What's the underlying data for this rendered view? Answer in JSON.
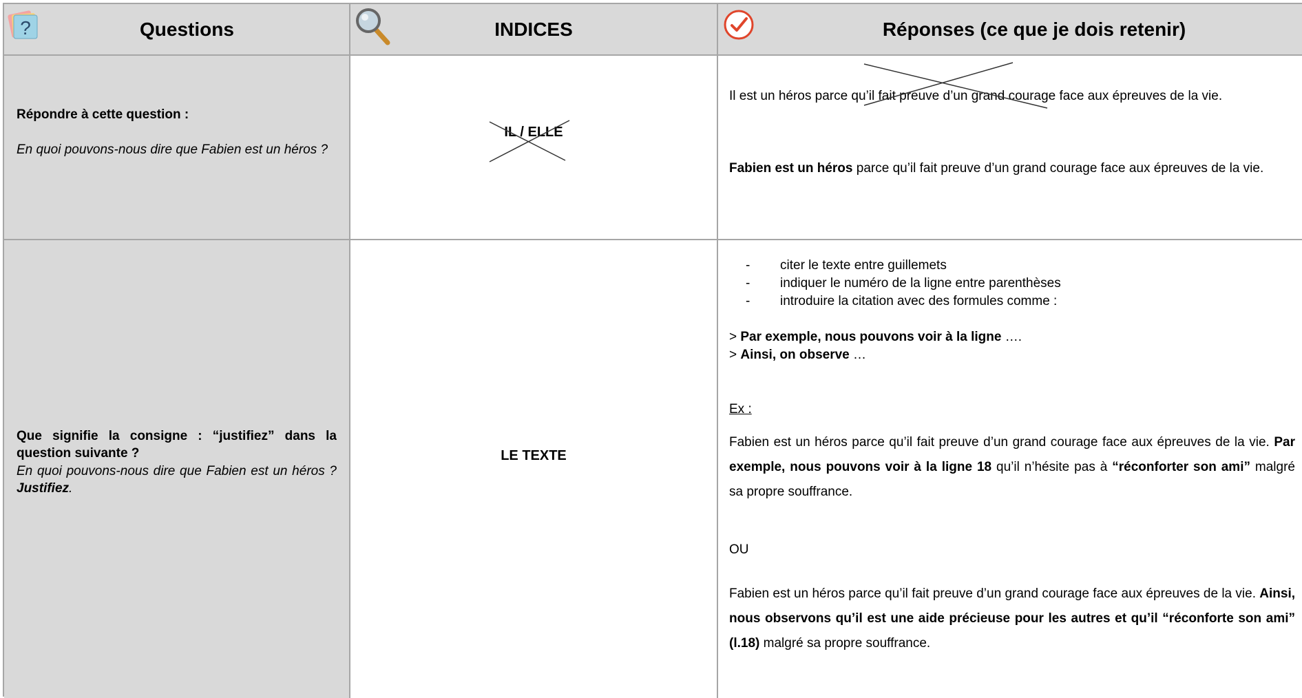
{
  "header": {
    "questions": "Questions",
    "indices": "INDICES",
    "reponses": "Réponses (ce que je dois retenir)",
    "question_icon": "question-mark-sticky-icon",
    "magnifier_icon": "magnifying-glass-icon",
    "check_icon": "checkmark-circle-icon",
    "accent_color": "#e0452b"
  },
  "row1": {
    "question_bold": "Répondre à cette question :",
    "question_italic": "En quoi pouvons-nous dire que Fabien est un héros ?",
    "indice": "IL / ELLE",
    "answer_wrong": "Il est un héros parce qu’il fait preuve d’un grand courage face aux épreuves de la vie.",
    "answer_right_bold": "Fabien est un héros",
    "answer_right_rest": " parce qu’il fait preuve d’un grand courage face aux épreuves de la vie."
  },
  "row2": {
    "question_bold": "Que signifie la consigne : “justifiez” dans la question suivante ?",
    "question_italic": "En quoi pouvons-nous dire que Fabien est un héros ? ",
    "question_italic_bold": "Justifiez",
    "question_italic_end": ".",
    "indice": "LE TEXTE",
    "bullets": [
      "citer le texte entre guillemets",
      "indiquer le numéro de la ligne entre parenthèses",
      "introduire la citation avec des formules comme :"
    ],
    "formula1_prefix": "> ",
    "formula1_bold": "Par exemple, nous pouvons voir à la ligne",
    "formula1_rest": " ….",
    "formula2_prefix": "> ",
    "formula2_bold": "Ainsi, on observe",
    "formula2_rest": " …",
    "ex_label": "Ex :",
    "ex1_a": "Fabien est un héros parce qu’il fait preuve d’un grand courage face aux épreuves de la vie. ",
    "ex1_b": "Par exemple, nous pouvons voir à la ligne 18",
    "ex1_c": " qu’il n’hésite pas à ",
    "ex1_d": "“réconforter son ami”",
    "ex1_e": " malgré sa propre souffrance.",
    "ou": "OU",
    "ex2_a": "Fabien est un héros parce qu’il fait preuve d’un grand courage face aux épreuves de la vie. ",
    "ex2_b": "Ainsi, nous observons qu’il est une aide précieuse pour les autres et qu’il “réconforte son ami” (l.18)",
    "ex2_c": "  malgré sa propre souffrance."
  }
}
